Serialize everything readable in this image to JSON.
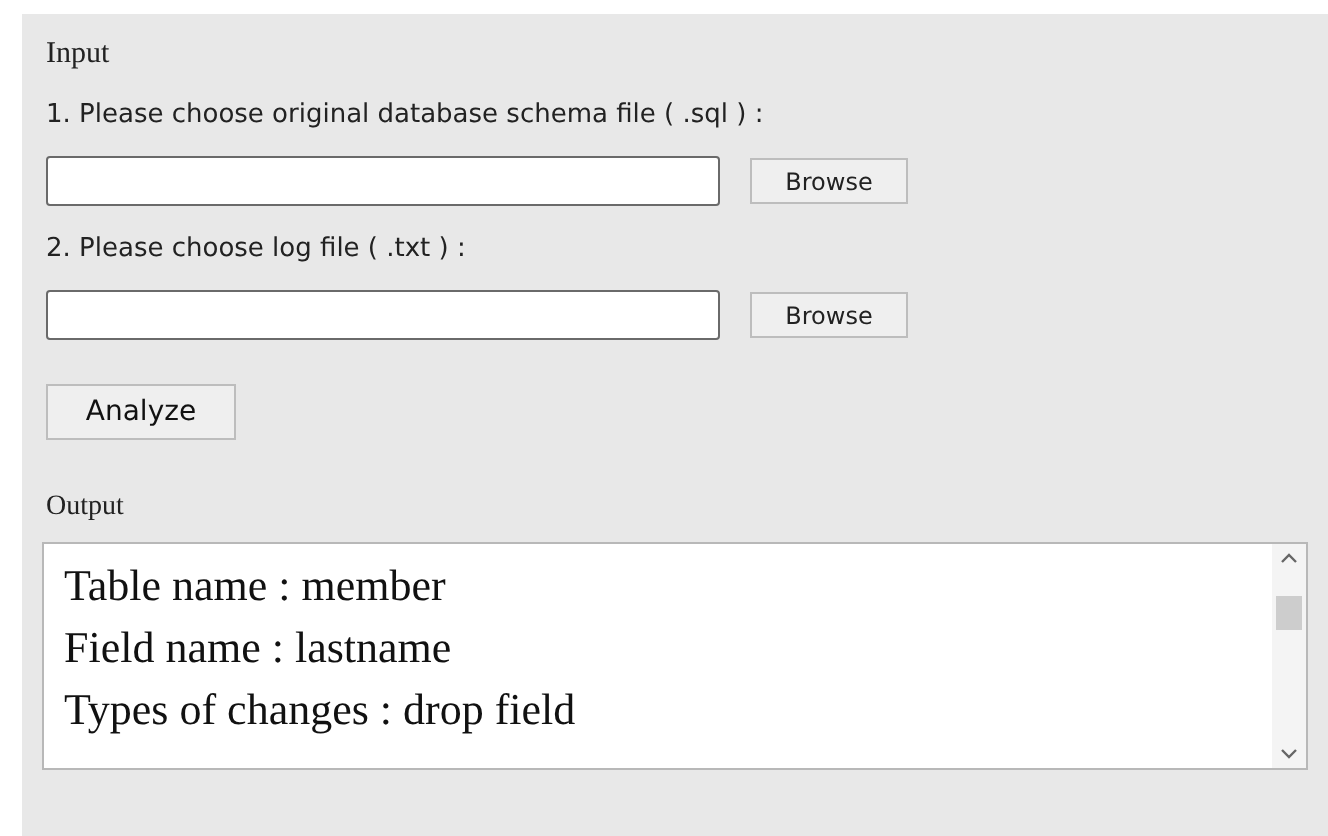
{
  "input_section": {
    "heading": "Input",
    "files": [
      {
        "label": "1. Please choose original database schema file ( .sql ) :",
        "button": "Browse"
      },
      {
        "label": "2. Please choose log file ( .txt ) :",
        "button": "Browse"
      }
    ],
    "analyze_button": "Analyze"
  },
  "output_section": {
    "heading": "Output",
    "lines": [
      "Table name : member",
      "Field name : lastname",
      "Types of changes : drop field"
    ]
  }
}
